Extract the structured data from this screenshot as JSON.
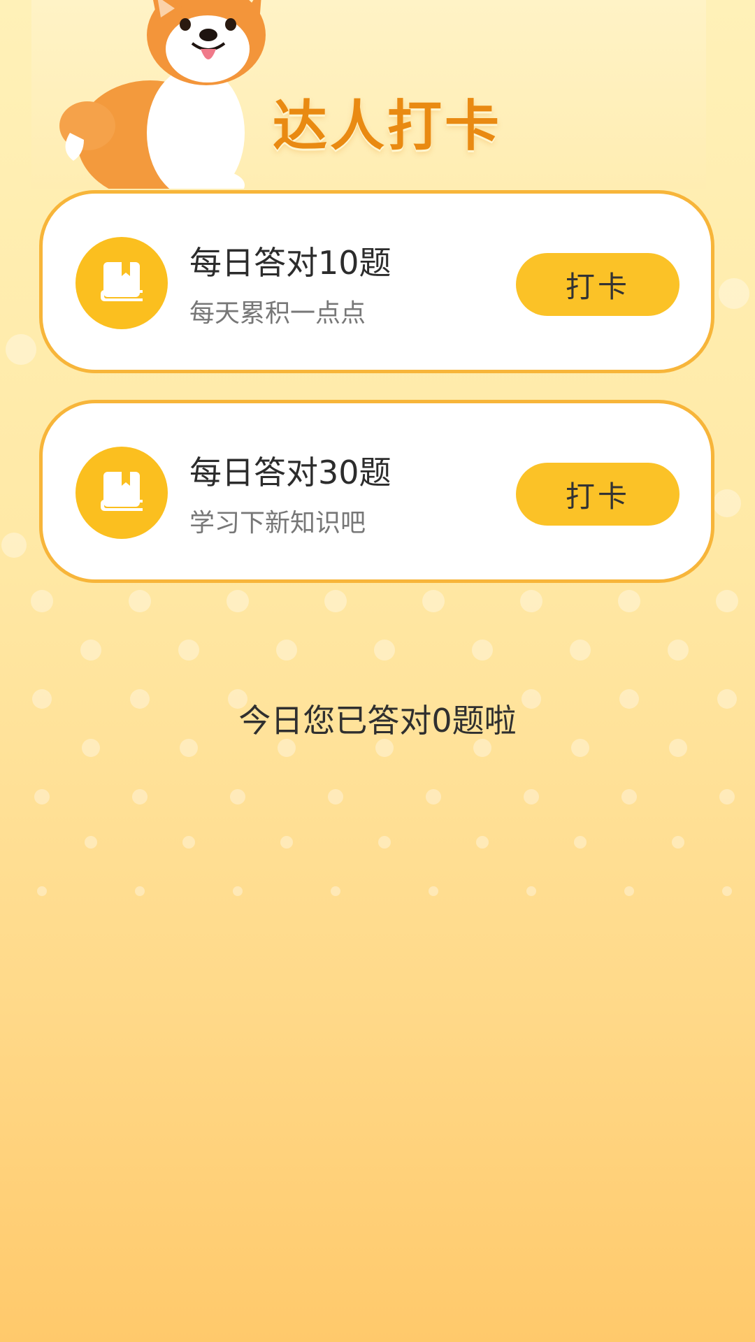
{
  "header": {
    "title": "达人打卡",
    "mascot_icon": "corgi-mascot-icon"
  },
  "tasks": [
    {
      "title": "每日答对10题",
      "subtitle": "每天累积一点点",
      "icon": "book-icon",
      "button_label": "打卡"
    },
    {
      "title": "每日答对30题",
      "subtitle": "学习下新知识吧",
      "icon": "book-icon",
      "button_label": "打卡"
    }
  ],
  "summary": {
    "text": "今日您已答对0题啦"
  },
  "colors": {
    "accent": "#fbc227",
    "card_border": "#f7b53a",
    "title_orange": "#e98a12",
    "icon_circle": "#fbbf1f"
  }
}
